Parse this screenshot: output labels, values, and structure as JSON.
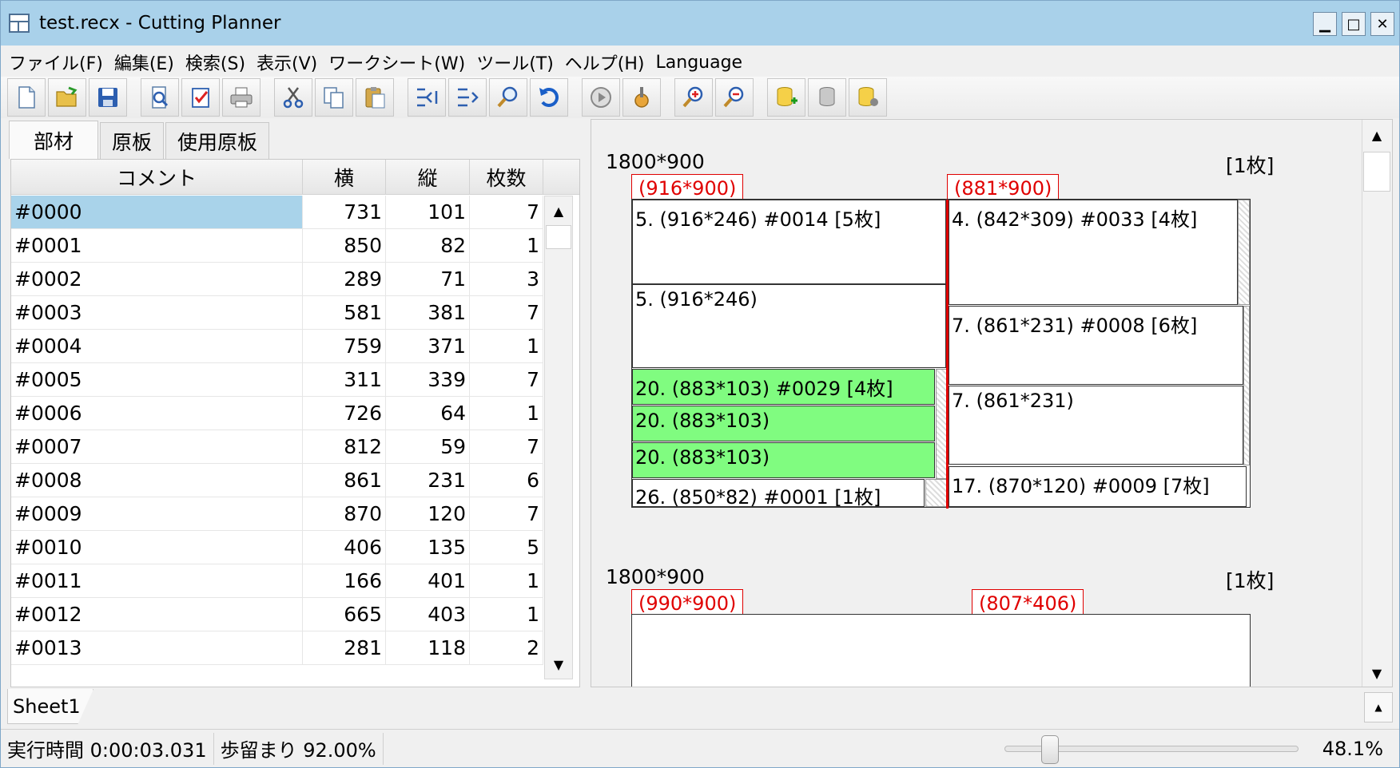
{
  "window": {
    "title": "test.recx - Cutting Planner",
    "minimize": "▁",
    "maximize": "□",
    "close": "✕"
  },
  "menu": [
    "ファイル(F)",
    "編集(E)",
    "検索(S)",
    "表示(V)",
    "ワークシート(W)",
    "ツール(T)",
    "ヘルプ(H)",
    "Language"
  ],
  "toolbar": {
    "groups": [
      [
        "new-icon",
        "open-icon",
        "save-icon"
      ],
      [
        "preview-icon",
        "check-icon",
        "print-icon"
      ],
      [
        "cut-icon",
        "copy-icon",
        "paste-icon"
      ],
      [
        "insert-row-icon",
        "append-row-icon",
        "find-icon",
        "undo-icon"
      ],
      [
        "run-icon",
        "settings-icon"
      ],
      [
        "zoom-in-icon",
        "zoom-out-icon"
      ],
      [
        "db-add-icon",
        "db-icon",
        "db-settings-icon"
      ]
    ]
  },
  "tabs": [
    "部材",
    "原板",
    "使用原板"
  ],
  "grid": {
    "headers": [
      "コメント",
      "横",
      "縦",
      "枚数"
    ],
    "rows": [
      [
        "#0000",
        "731",
        "101",
        "7"
      ],
      [
        "#0001",
        "850",
        "82",
        "1"
      ],
      [
        "#0002",
        "289",
        "71",
        "3"
      ],
      [
        "#0003",
        "581",
        "381",
        "7"
      ],
      [
        "#0004",
        "759",
        "371",
        "1"
      ],
      [
        "#0005",
        "311",
        "339",
        "7"
      ],
      [
        "#0006",
        "726",
        "64",
        "1"
      ],
      [
        "#0007",
        "812",
        "59",
        "7"
      ],
      [
        "#0008",
        "861",
        "231",
        "6"
      ],
      [
        "#0009",
        "870",
        "120",
        "7"
      ],
      [
        "#0010",
        "406",
        "135",
        "5"
      ],
      [
        "#0011",
        "166",
        "401",
        "1"
      ],
      [
        "#0012",
        "665",
        "403",
        "1"
      ],
      [
        "#0013",
        "281",
        "118",
        "2"
      ]
    ],
    "selected_row": 0
  },
  "layout1": {
    "size": "1800*900",
    "count": "[1枚]",
    "strip_labels": [
      "(916*900)",
      "(881*900)"
    ],
    "pieces": [
      "5. (916*246) #0014 [5枚]",
      "5. (916*246)",
      "20. (883*103) #0029 [4枚]",
      "20. (883*103)",
      "20. (883*103)",
      "26. (850*82) #0001 [1枚]",
      "4. (842*309) #0033 [4枚]",
      "7. (861*231) #0008 [6枚]",
      "7. (861*231)",
      "17. (870*120) #0009 [7枚]"
    ],
    "colors": {
      "highlight": "#80fc80",
      "cut_line": "#e00000"
    }
  },
  "layout2": {
    "size": "1800*900",
    "count": "[1枚]",
    "strip_labels": [
      "(990*900)",
      "(807*406)"
    ]
  },
  "sheet_tab": "Sheet1",
  "status": {
    "elapsed": "実行時間 0:00:03.031",
    "yield": "歩留まり 92.00%",
    "zoom": "48.1%",
    "zoom_fraction": 0.13
  }
}
